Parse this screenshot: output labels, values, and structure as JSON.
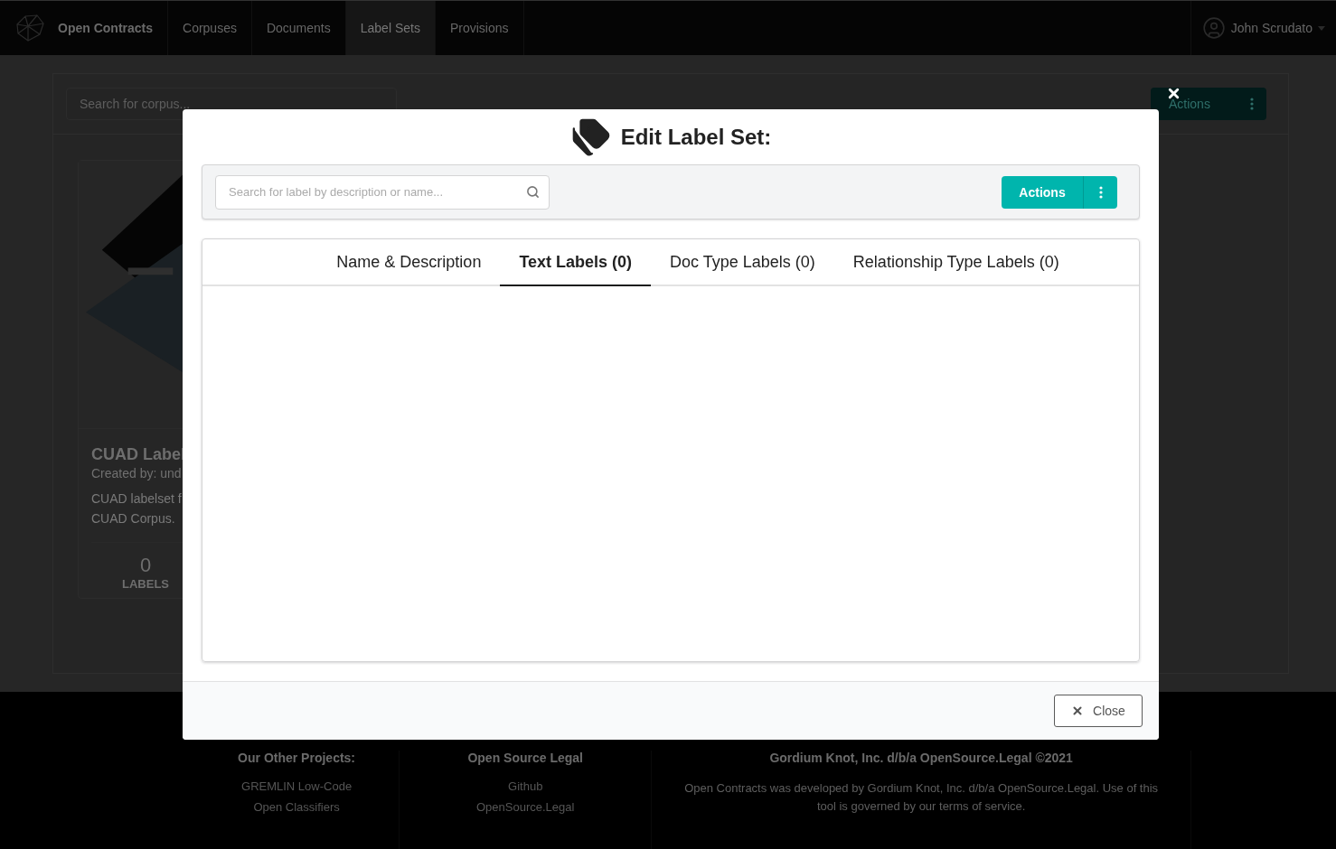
{
  "navbar": {
    "brand": "Open Contracts",
    "items": [
      {
        "label": "Corpuses",
        "selected": false
      },
      {
        "label": "Documents",
        "selected": false
      },
      {
        "label": "Label Sets",
        "selected": true
      },
      {
        "label": "Provisions",
        "selected": false
      }
    ],
    "user": "John Scrudato"
  },
  "page": {
    "search": {
      "placeholder": "Search for corpus..."
    },
    "actions_label": "Actions",
    "cards": [
      {
        "kind": "picture",
        "title": "CUAD Label",
        "created_by": "Created by: und",
        "description": [
          "CUAD labelset f",
          "CUAD Corpus."
        ],
        "count": "0",
        "count_label": "LABELS"
      }
    ]
  },
  "modal": {
    "title": "Edit Label Set:",
    "search": {
      "placeholder": "Search for label by description or name..."
    },
    "actions_label": "Actions",
    "tabs": [
      {
        "label": "Name & Description",
        "selected": false
      },
      {
        "label": "Text Labels (0)",
        "selected": true
      },
      {
        "label": "Doc Type Labels (0)",
        "selected": false
      },
      {
        "label": "Relationship Type Labels (0)",
        "selected": false
      }
    ],
    "close_label": "Close"
  },
  "footer": {
    "columns": [
      {
        "heading": "Our Other Projects:",
        "links": [
          "GREMLIN Low-Code",
          "Open Classifiers"
        ]
      },
      {
        "heading": "Open Source Legal",
        "links": [
          "Github",
          "OpenSource.Legal"
        ]
      },
      {
        "heading": "Gordium Knot, Inc. d/b/a OpenSource.Legal ©2021",
        "text": "Open Contracts was developed by Gordium Knot, Inc. d/b/a OpenSource.Legal. Use of this tool is governed by our terms of service."
      }
    ]
  }
}
